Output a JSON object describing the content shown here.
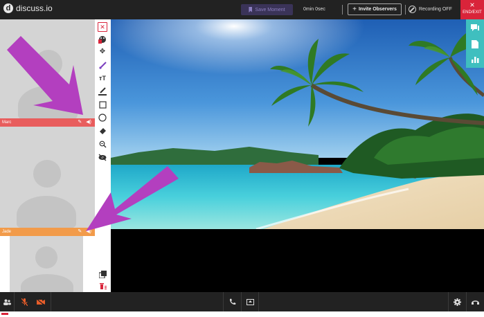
{
  "app": {
    "logo_letter": "d",
    "name": "discuss.io"
  },
  "header": {
    "save_moment_label": "Save Moment",
    "timer": "0min 0sec",
    "invite_label": "Invite Observers",
    "invite_plus": "+",
    "recording_label": "Recording OFF",
    "end_exit_label": "END/EXIT",
    "end_icon": "×"
  },
  "participants": [
    {
      "name": "Marc",
      "color": "#e85d5d"
    },
    {
      "name": "Jade",
      "color": "#f29b4a"
    }
  ],
  "icons": {
    "tools": [
      "close-icon",
      "palette-icon",
      "move-icon",
      "brush-icon",
      "text-size-icon",
      "pen-icon",
      "rectangle-icon",
      "circle-icon",
      "eraser-icon",
      "zoom-icon",
      "hide-icon",
      "layers-icon",
      "trash-icon"
    ],
    "right_panel": [
      "chat-icon",
      "notes-icon",
      "chart-icon"
    ],
    "bottom": [
      "participants-icon",
      "mic-muted-icon",
      "camera-off-icon",
      "phone-icon",
      "screen-share-icon",
      "settings-icon",
      "exit-icon"
    ]
  },
  "colors": {
    "accent_teal": "#3fbfbf",
    "end_red": "#d9243a",
    "annotation_purple": "#b33fbf"
  }
}
